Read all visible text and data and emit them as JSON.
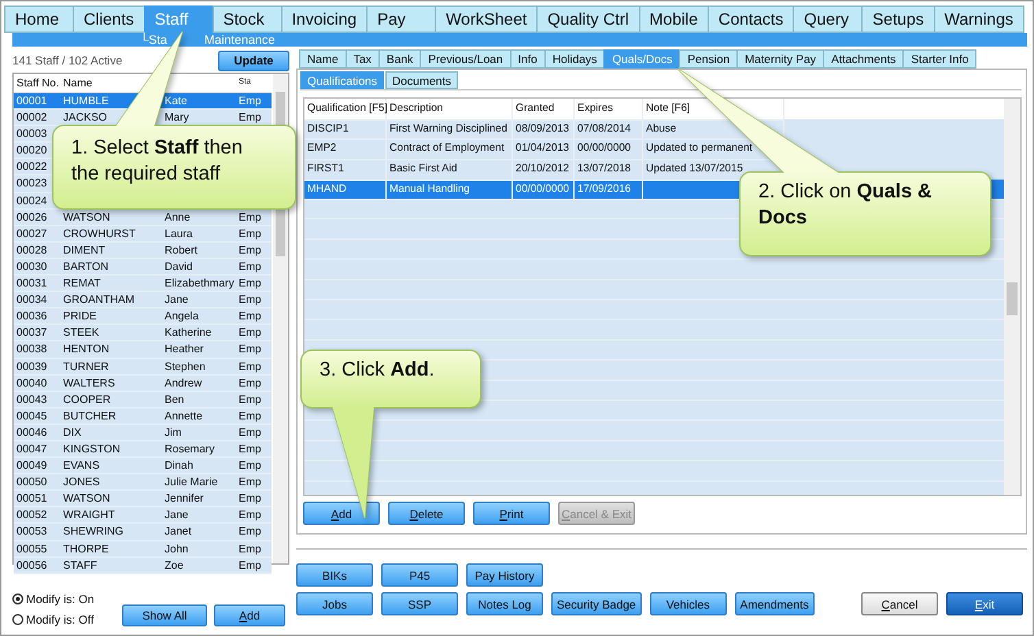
{
  "main_tabs": [
    {
      "label": "Home",
      "selected": false
    },
    {
      "label": "Clients",
      "selected": false
    },
    {
      "label": "Staff",
      "selected": true
    },
    {
      "label": "Stock",
      "selected": false
    },
    {
      "label": "Invoicing",
      "selected": false
    },
    {
      "label": "Pay",
      "selected": false
    },
    {
      "label": "WorkSheet",
      "selected": false
    },
    {
      "label": "Quality Ctrl",
      "selected": false
    },
    {
      "label": "Mobile",
      "selected": false
    },
    {
      "label": "Contacts",
      "selected": false
    },
    {
      "label": "Query",
      "selected": false
    },
    {
      "label": "Setups",
      "selected": false
    },
    {
      "label": "Warnings",
      "selected": false
    }
  ],
  "section_title": [
    "└Sta",
    "Maintenance"
  ],
  "staff_count": "141 Staff / 102 Active",
  "update_button": "Update",
  "staff_table": {
    "columns": [
      "Staff No.",
      "Name",
      "Sta"
    ],
    "rows": [
      {
        "no": "00001",
        "surname": "HUMBLE",
        "first": "Kate",
        "status": "Emp",
        "selected": true
      },
      {
        "no": "00002",
        "surname": "JACKSO",
        "first": "Mary",
        "status": "Emp",
        "selected": false
      },
      {
        "no": "00003",
        "selected": false
      },
      {
        "no": "00020",
        "selected": false
      },
      {
        "no": "00022",
        "selected": false
      },
      {
        "no": "00023",
        "selected": false
      },
      {
        "no": "00024",
        "selected": false
      },
      {
        "no": "00026",
        "surname": "WATSON",
        "first": "Anne",
        "status": "Emp",
        "selected": false
      },
      {
        "no": "00027",
        "surname": "CROWHURST",
        "first": "Laura",
        "status": "Emp",
        "selected": false
      },
      {
        "no": "00028",
        "surname": "DIMENT",
        "first": "Robert",
        "status": "Emp",
        "selected": false
      },
      {
        "no": "00030",
        "surname": "BARTON",
        "first": "David",
        "status": "Emp",
        "selected": false
      },
      {
        "no": "00031",
        "surname": "REMAT",
        "first": "Elizabethmary",
        "status": "Emp",
        "selected": false
      },
      {
        "no": "00034",
        "surname": "GROANTHAM",
        "first": "Jane",
        "status": "Emp",
        "selected": false
      },
      {
        "no": "00036",
        "surname": "PRIDE",
        "first": "Angela",
        "status": "Emp",
        "selected": false
      },
      {
        "no": "00037",
        "surname": "STEEK",
        "first": "Katherine",
        "status": "Emp",
        "selected": false
      },
      {
        "no": "00038",
        "surname": "HENTON",
        "first": "Heather",
        "status": "Emp",
        "selected": false
      },
      {
        "no": "00039",
        "surname": "TURNER",
        "first": "Stephen",
        "status": "Emp",
        "selected": false
      },
      {
        "no": "00040",
        "surname": "WALTERS",
        "first": "Andrew",
        "status": "Emp",
        "selected": false
      },
      {
        "no": "00043",
        "surname": "COOPER",
        "first": "Ben",
        "status": "Emp",
        "selected": false
      },
      {
        "no": "00045",
        "surname": "BUTCHER",
        "first": "Annette",
        "status": "Emp",
        "selected": false
      },
      {
        "no": "00046",
        "surname": "DIX",
        "first": "Jim",
        "status": "Emp",
        "selected": false
      },
      {
        "no": "00047",
        "surname": "KINGSTON",
        "first": "Rosemary",
        "status": "Emp",
        "selected": false
      },
      {
        "no": "00049",
        "surname": "EVANS",
        "first": "Dinah",
        "status": "Emp",
        "selected": false
      },
      {
        "no": "00050",
        "surname": "JONES",
        "first": "Julie Marie",
        "status": "Emp",
        "selected": false
      },
      {
        "no": "00051",
        "surname": "WATSON",
        "first": "Jennifer",
        "status": "Emp",
        "selected": false
      },
      {
        "no": "00052",
        "surname": "WRAIGHT",
        "first": "Jane",
        "status": "Emp",
        "selected": false
      },
      {
        "no": "00053",
        "surname": "SHEWRING",
        "first": "Janet",
        "status": "Emp",
        "selected": false
      },
      {
        "no": "00055",
        "surname": "THORPE",
        "first": "John",
        "status": "Emp",
        "selected": false
      },
      {
        "no": "00056",
        "surname": "STAFF",
        "first": "Zoe",
        "status": "Emp",
        "selected": false
      }
    ]
  },
  "modify_options": [
    {
      "label": "Modify is: On",
      "selected": true
    },
    {
      "label": "Modify is: Off",
      "selected": false
    }
  ],
  "left_buttons": [
    "Show All",
    "Add"
  ],
  "detail_tabs": [
    {
      "label": "Name",
      "selected": false
    },
    {
      "label": "Tax",
      "selected": false
    },
    {
      "label": "Bank",
      "selected": false
    },
    {
      "label": "Previous/Loan",
      "selected": false
    },
    {
      "label": "Info",
      "selected": false
    },
    {
      "label": "Holidays",
      "selected": false
    },
    {
      "label": "Quals/Docs",
      "selected": true
    },
    {
      "label": "Pension",
      "selected": false
    },
    {
      "label": "Maternity Pay",
      "selected": false
    },
    {
      "label": "Attachments",
      "selected": false
    },
    {
      "label": "Starter Info",
      "selected": false
    }
  ],
  "sub_tabs": [
    {
      "label": "Qualifications",
      "selected": true
    },
    {
      "label": "Documents",
      "selected": false
    }
  ],
  "qual_table": {
    "columns": [
      "Qualification [F5]",
      "Description",
      "Granted",
      "Expires",
      "Note [F6]"
    ],
    "rows": [
      {
        "code": "DISCIP1",
        "description": "First Warning Disciplined",
        "granted": "08/09/2013",
        "expires": "07/08/2014",
        "note": "Abuse",
        "selected": false
      },
      {
        "code": "EMP2",
        "description": "Contract of Employment",
        "granted": "01/04/2013",
        "expires": "00/00/0000",
        "note": "Updated to permanent",
        "selected": false
      },
      {
        "code": "FIRST1",
        "description": "Basic First Aid",
        "granted": "20/10/2012",
        "expires": "13/07/2018",
        "note": "Updated 13/07/2015",
        "selected": false
      },
      {
        "code": "MHAND",
        "description": "Manual Handling",
        "granted": "00/00/0000",
        "expires": "17/09/2016",
        "selected": true
      }
    ]
  },
  "qual_buttons": [
    {
      "label": "Add",
      "disabled": false
    },
    {
      "label": "Delete",
      "disabled": false
    },
    {
      "label": "Print",
      "disabled": false
    },
    {
      "label": "Cancel & Exit",
      "disabled": true
    }
  ],
  "bottom_buttons_row1": [
    "BIKs",
    "P45",
    "Pay History"
  ],
  "bottom_buttons_row2": [
    "Jobs",
    "SSP",
    "Notes Log",
    "Security Badge",
    "Vehicles",
    "Amendments"
  ],
  "dialog_buttons": [
    {
      "label": "Cancel",
      "kind": "secondary"
    },
    {
      "label": "Exit",
      "kind": "primary"
    }
  ],
  "callouts": [
    "1. Select **Staff** then the required staff",
    "2. Click on **Quals & Docs**",
    "3. Click **Add**."
  ]
}
